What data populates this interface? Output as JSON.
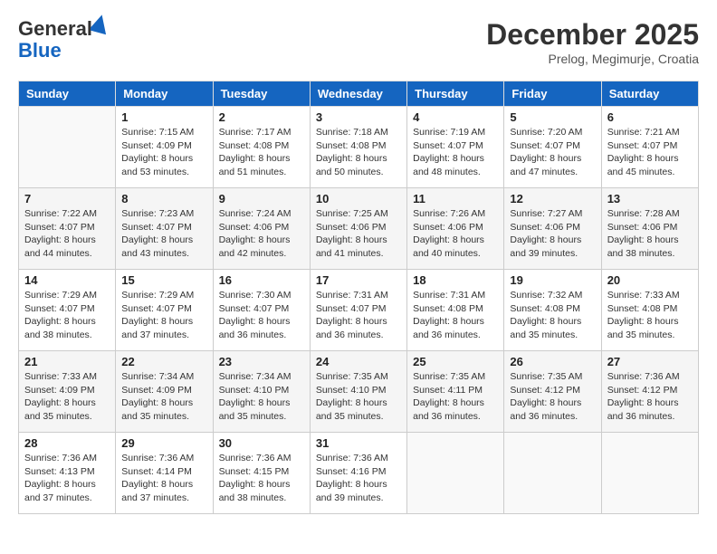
{
  "header": {
    "logo_general": "General",
    "logo_blue": "Blue",
    "month_title": "December 2025",
    "location": "Prelog, Megimurje, Croatia"
  },
  "weekdays": [
    "Sunday",
    "Monday",
    "Tuesday",
    "Wednesday",
    "Thursday",
    "Friday",
    "Saturday"
  ],
  "weeks": [
    [
      {
        "day": "",
        "info": ""
      },
      {
        "day": "1",
        "info": "Sunrise: 7:15 AM\nSunset: 4:09 PM\nDaylight: 8 hours\nand 53 minutes."
      },
      {
        "day": "2",
        "info": "Sunrise: 7:17 AM\nSunset: 4:08 PM\nDaylight: 8 hours\nand 51 minutes."
      },
      {
        "day": "3",
        "info": "Sunrise: 7:18 AM\nSunset: 4:08 PM\nDaylight: 8 hours\nand 50 minutes."
      },
      {
        "day": "4",
        "info": "Sunrise: 7:19 AM\nSunset: 4:07 PM\nDaylight: 8 hours\nand 48 minutes."
      },
      {
        "day": "5",
        "info": "Sunrise: 7:20 AM\nSunset: 4:07 PM\nDaylight: 8 hours\nand 47 minutes."
      },
      {
        "day": "6",
        "info": "Sunrise: 7:21 AM\nSunset: 4:07 PM\nDaylight: 8 hours\nand 45 minutes."
      }
    ],
    [
      {
        "day": "7",
        "info": "Sunrise: 7:22 AM\nSunset: 4:07 PM\nDaylight: 8 hours\nand 44 minutes."
      },
      {
        "day": "8",
        "info": "Sunrise: 7:23 AM\nSunset: 4:07 PM\nDaylight: 8 hours\nand 43 minutes."
      },
      {
        "day": "9",
        "info": "Sunrise: 7:24 AM\nSunset: 4:06 PM\nDaylight: 8 hours\nand 42 minutes."
      },
      {
        "day": "10",
        "info": "Sunrise: 7:25 AM\nSunset: 4:06 PM\nDaylight: 8 hours\nand 41 minutes."
      },
      {
        "day": "11",
        "info": "Sunrise: 7:26 AM\nSunset: 4:06 PM\nDaylight: 8 hours\nand 40 minutes."
      },
      {
        "day": "12",
        "info": "Sunrise: 7:27 AM\nSunset: 4:06 PM\nDaylight: 8 hours\nand 39 minutes."
      },
      {
        "day": "13",
        "info": "Sunrise: 7:28 AM\nSunset: 4:06 PM\nDaylight: 8 hours\nand 38 minutes."
      }
    ],
    [
      {
        "day": "14",
        "info": "Sunrise: 7:29 AM\nSunset: 4:07 PM\nDaylight: 8 hours\nand 38 minutes."
      },
      {
        "day": "15",
        "info": "Sunrise: 7:29 AM\nSunset: 4:07 PM\nDaylight: 8 hours\nand 37 minutes."
      },
      {
        "day": "16",
        "info": "Sunrise: 7:30 AM\nSunset: 4:07 PM\nDaylight: 8 hours\nand 36 minutes."
      },
      {
        "day": "17",
        "info": "Sunrise: 7:31 AM\nSunset: 4:07 PM\nDaylight: 8 hours\nand 36 minutes."
      },
      {
        "day": "18",
        "info": "Sunrise: 7:31 AM\nSunset: 4:08 PM\nDaylight: 8 hours\nand 36 minutes."
      },
      {
        "day": "19",
        "info": "Sunrise: 7:32 AM\nSunset: 4:08 PM\nDaylight: 8 hours\nand 35 minutes."
      },
      {
        "day": "20",
        "info": "Sunrise: 7:33 AM\nSunset: 4:08 PM\nDaylight: 8 hours\nand 35 minutes."
      }
    ],
    [
      {
        "day": "21",
        "info": "Sunrise: 7:33 AM\nSunset: 4:09 PM\nDaylight: 8 hours\nand 35 minutes."
      },
      {
        "day": "22",
        "info": "Sunrise: 7:34 AM\nSunset: 4:09 PM\nDaylight: 8 hours\nand 35 minutes."
      },
      {
        "day": "23",
        "info": "Sunrise: 7:34 AM\nSunset: 4:10 PM\nDaylight: 8 hours\nand 35 minutes."
      },
      {
        "day": "24",
        "info": "Sunrise: 7:35 AM\nSunset: 4:10 PM\nDaylight: 8 hours\nand 35 minutes."
      },
      {
        "day": "25",
        "info": "Sunrise: 7:35 AM\nSunset: 4:11 PM\nDaylight: 8 hours\nand 36 minutes."
      },
      {
        "day": "26",
        "info": "Sunrise: 7:35 AM\nSunset: 4:12 PM\nDaylight: 8 hours\nand 36 minutes."
      },
      {
        "day": "27",
        "info": "Sunrise: 7:36 AM\nSunset: 4:12 PM\nDaylight: 8 hours\nand 36 minutes."
      }
    ],
    [
      {
        "day": "28",
        "info": "Sunrise: 7:36 AM\nSunset: 4:13 PM\nDaylight: 8 hours\nand 37 minutes."
      },
      {
        "day": "29",
        "info": "Sunrise: 7:36 AM\nSunset: 4:14 PM\nDaylight: 8 hours\nand 37 minutes."
      },
      {
        "day": "30",
        "info": "Sunrise: 7:36 AM\nSunset: 4:15 PM\nDaylight: 8 hours\nand 38 minutes."
      },
      {
        "day": "31",
        "info": "Sunrise: 7:36 AM\nSunset: 4:16 PM\nDaylight: 8 hours\nand 39 minutes."
      },
      {
        "day": "",
        "info": ""
      },
      {
        "day": "",
        "info": ""
      },
      {
        "day": "",
        "info": ""
      }
    ]
  ]
}
